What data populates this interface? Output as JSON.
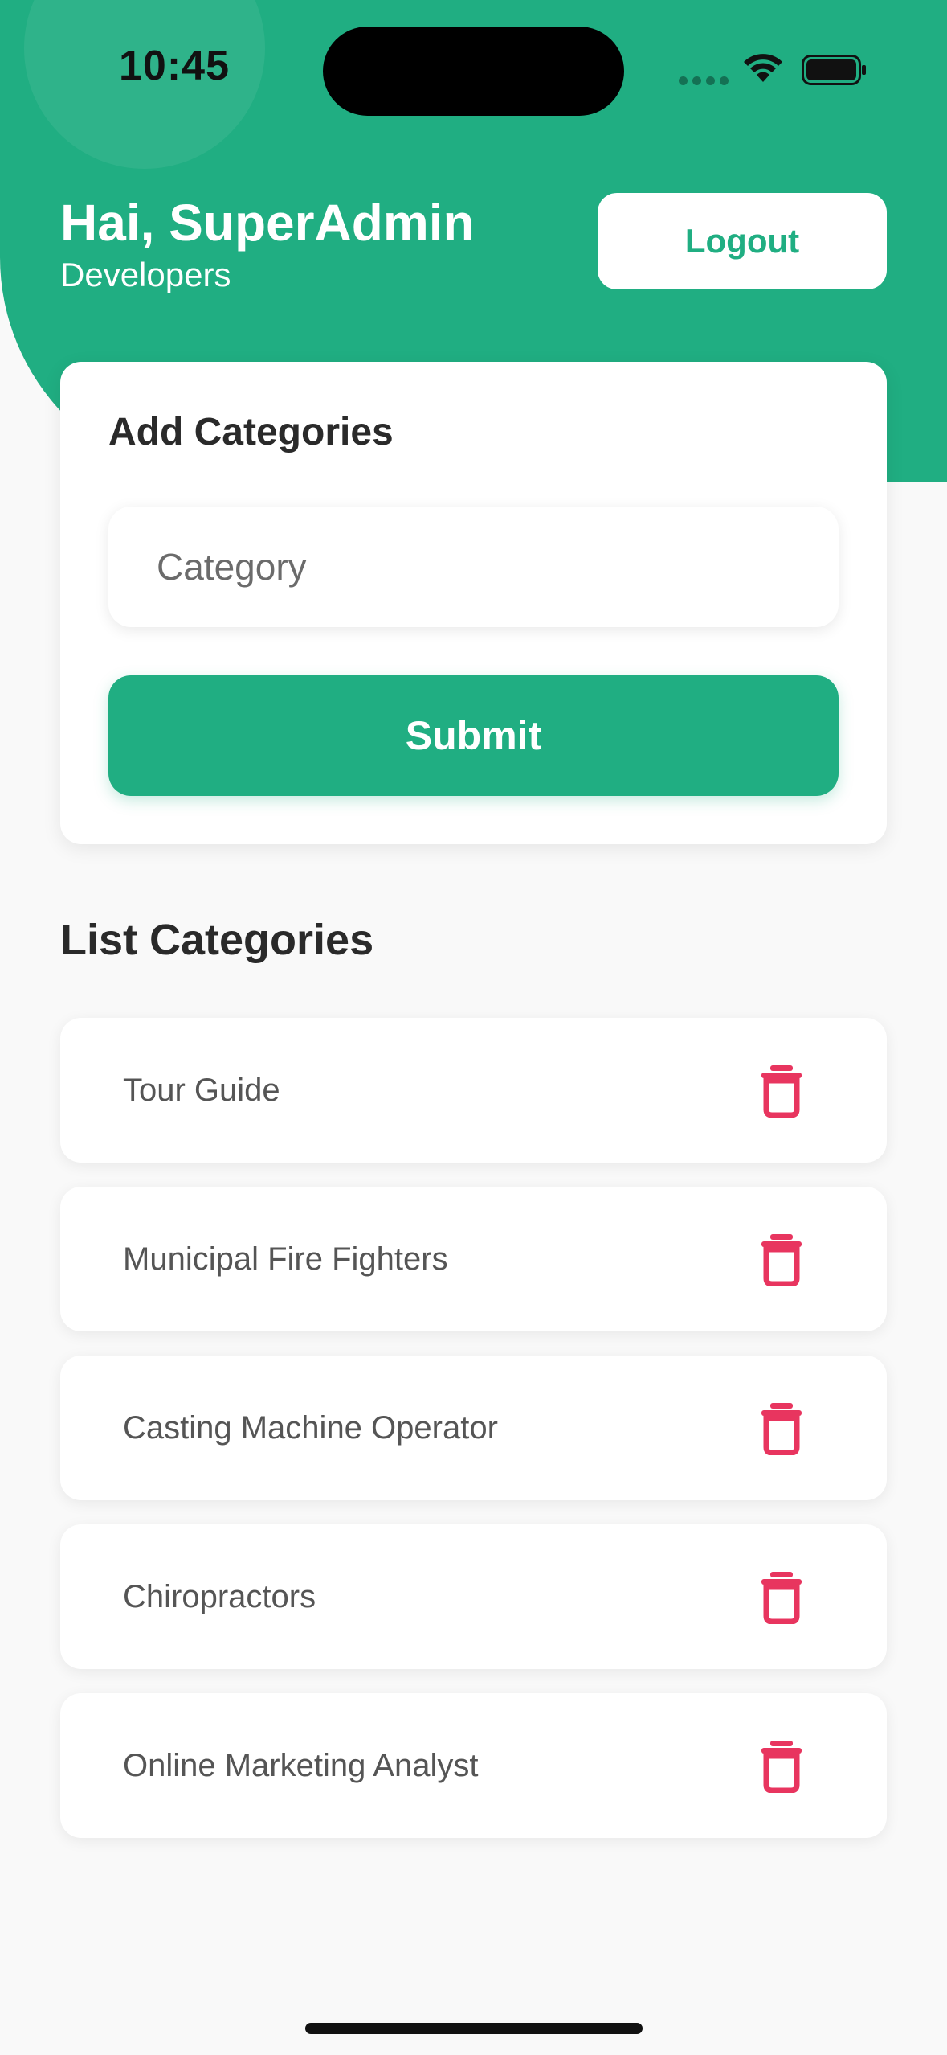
{
  "status_bar": {
    "time": "10:45"
  },
  "header": {
    "greeting": "Hai, SuperAdmin",
    "subtitle": "Developers",
    "logout_label": "Logout"
  },
  "add_card": {
    "title": "Add Categories",
    "input_placeholder": "Category",
    "input_value": "",
    "submit_label": "Submit"
  },
  "list": {
    "title": "List Categories",
    "items": [
      {
        "label": "Tour Guide"
      },
      {
        "label": "Municipal Fire Fighters"
      },
      {
        "label": "Casting Machine Operator"
      },
      {
        "label": "Chiropractors"
      },
      {
        "label": "Online Marketing Analyst"
      }
    ],
    "delete_icon": "trash-icon"
  },
  "colors": {
    "accent": "#20ae82",
    "delete": "#e8355f",
    "background": "#f9f9f9"
  }
}
